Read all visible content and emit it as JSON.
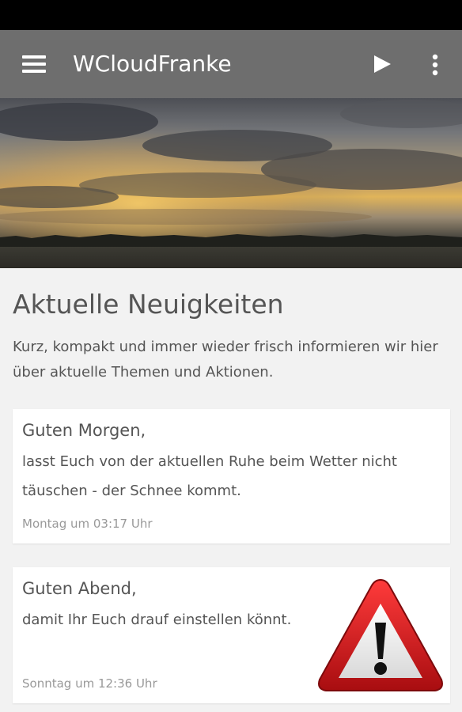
{
  "app": {
    "title": "WCloudFranke"
  },
  "toolbar": {
    "menu_icon": "hamburger-menu-icon",
    "play_icon": "play-icon",
    "more_icon": "more-vertical-icon"
  },
  "hero": {
    "image": "stormy-sunset-landscape"
  },
  "news": {
    "title": "Aktuelle Neuigkeiten",
    "description": "Kurz, kompakt und immer wieder frisch informieren wir hier über aktuelle Themen und Aktionen.",
    "posts": [
      {
        "title": "Guten Morgen,",
        "body": "lasst Euch von der aktuellen Ruhe beim Wetter nicht täuschen - der Schnee kommt.",
        "time": "Montag um 03:17 Uhr"
      },
      {
        "title": "Guten Abend,",
        "body": "damit Ihr Euch drauf einstellen könnt.",
        "time": "Sonntag um 12:36 Uhr",
        "image": "warning-sign"
      }
    ]
  },
  "colors": {
    "appbar": "#6e6e6e",
    "statusbar": "#000000",
    "background": "#f2f2f2",
    "warning_red": "#d0161c"
  }
}
